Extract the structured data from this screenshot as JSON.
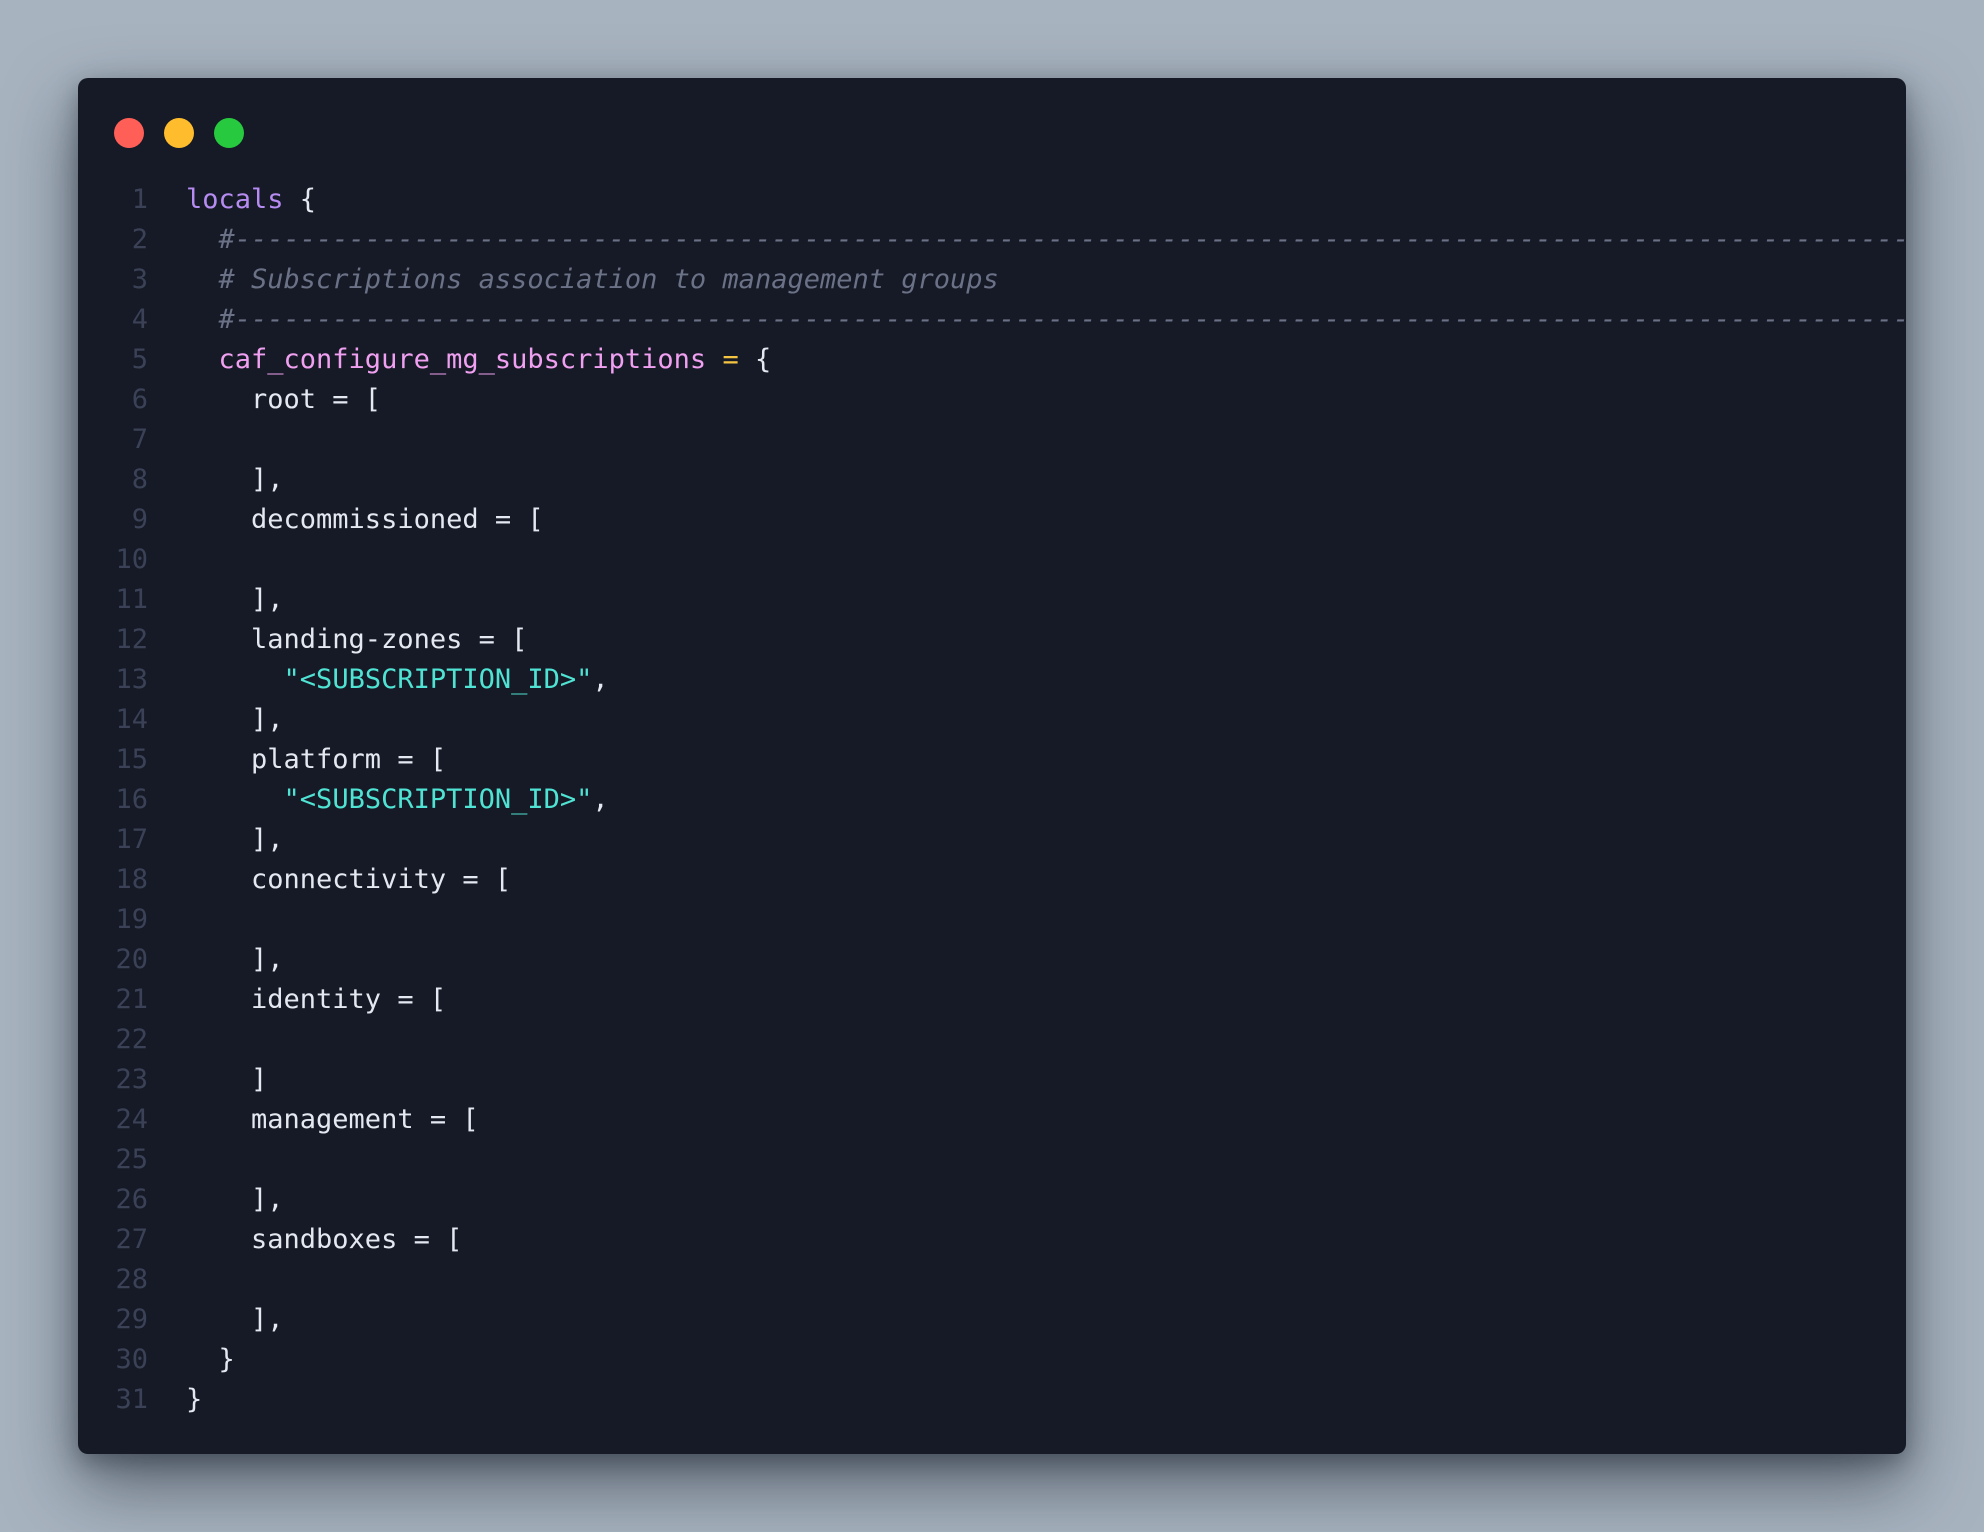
{
  "window": {
    "controls": [
      {
        "name": "close",
        "color": "#ff5f56"
      },
      {
        "name": "minimize",
        "color": "#ffbd2e"
      },
      {
        "name": "maximize",
        "color": "#27c93f"
      }
    ]
  },
  "code": {
    "lines": [
      {
        "n": "1",
        "tokens": [
          {
            "t": "locals",
            "c": "kw"
          },
          {
            "t": " {",
            "c": "plain"
          }
        ]
      },
      {
        "n": "2",
        "tokens": [
          {
            "t": "  #-------------------------------------------------------------------------------------------------------",
            "c": "cmt"
          }
        ]
      },
      {
        "n": "3",
        "tokens": [
          {
            "t": "  # Subscriptions association to management groups",
            "c": "cmt"
          }
        ]
      },
      {
        "n": "4",
        "tokens": [
          {
            "t": "  #-------------------------------------------------------------------------------------------------------",
            "c": "cmt"
          }
        ]
      },
      {
        "n": "5",
        "tokens": [
          {
            "t": "  caf_configure_mg_subscriptions",
            "c": "id"
          },
          {
            "t": " ",
            "c": "plain"
          },
          {
            "t": "=",
            "c": "op"
          },
          {
            "t": " {",
            "c": "plain"
          }
        ]
      },
      {
        "n": "6",
        "tokens": [
          {
            "t": "    root = [",
            "c": "plain"
          }
        ]
      },
      {
        "n": "7",
        "tokens": []
      },
      {
        "n": "8",
        "tokens": [
          {
            "t": "    ],",
            "c": "plain"
          }
        ]
      },
      {
        "n": "9",
        "tokens": [
          {
            "t": "    decommissioned = [",
            "c": "plain"
          }
        ]
      },
      {
        "n": "10",
        "tokens": []
      },
      {
        "n": "11",
        "tokens": [
          {
            "t": "    ],",
            "c": "plain"
          }
        ]
      },
      {
        "n": "12",
        "tokens": [
          {
            "t": "    landing-zones = [",
            "c": "plain"
          }
        ]
      },
      {
        "n": "13",
        "tokens": [
          {
            "t": "      ",
            "c": "plain"
          },
          {
            "t": "\"<SUBSCRIPTION_ID>\"",
            "c": "str"
          },
          {
            "t": ",",
            "c": "plain"
          }
        ]
      },
      {
        "n": "14",
        "tokens": [
          {
            "t": "    ],",
            "c": "plain"
          }
        ]
      },
      {
        "n": "15",
        "tokens": [
          {
            "t": "    platform = [",
            "c": "plain"
          }
        ]
      },
      {
        "n": "16",
        "tokens": [
          {
            "t": "      ",
            "c": "plain"
          },
          {
            "t": "\"<SUBSCRIPTION_ID>\"",
            "c": "str"
          },
          {
            "t": ",",
            "c": "plain"
          }
        ]
      },
      {
        "n": "17",
        "tokens": [
          {
            "t": "    ],",
            "c": "plain"
          }
        ]
      },
      {
        "n": "18",
        "tokens": [
          {
            "t": "    connectivity = [",
            "c": "plain"
          }
        ]
      },
      {
        "n": "19",
        "tokens": []
      },
      {
        "n": "20",
        "tokens": [
          {
            "t": "    ],",
            "c": "plain"
          }
        ]
      },
      {
        "n": "21",
        "tokens": [
          {
            "t": "    identity = [",
            "c": "plain"
          }
        ]
      },
      {
        "n": "22",
        "tokens": []
      },
      {
        "n": "23",
        "tokens": [
          {
            "t": "    ]",
            "c": "plain"
          }
        ]
      },
      {
        "n": "24",
        "tokens": [
          {
            "t": "    management = [",
            "c": "plain"
          }
        ]
      },
      {
        "n": "25",
        "tokens": []
      },
      {
        "n": "26",
        "tokens": [
          {
            "t": "    ],",
            "c": "plain"
          }
        ]
      },
      {
        "n": "27",
        "tokens": [
          {
            "t": "    sandboxes = [",
            "c": "plain"
          }
        ]
      },
      {
        "n": "28",
        "tokens": []
      },
      {
        "n": "29",
        "tokens": [
          {
            "t": "    ],",
            "c": "plain"
          }
        ]
      },
      {
        "n": "30",
        "tokens": [
          {
            "t": "  }",
            "c": "plain"
          }
        ]
      },
      {
        "n": "31",
        "tokens": [
          {
            "t": "}",
            "c": "plain"
          }
        ]
      }
    ]
  }
}
